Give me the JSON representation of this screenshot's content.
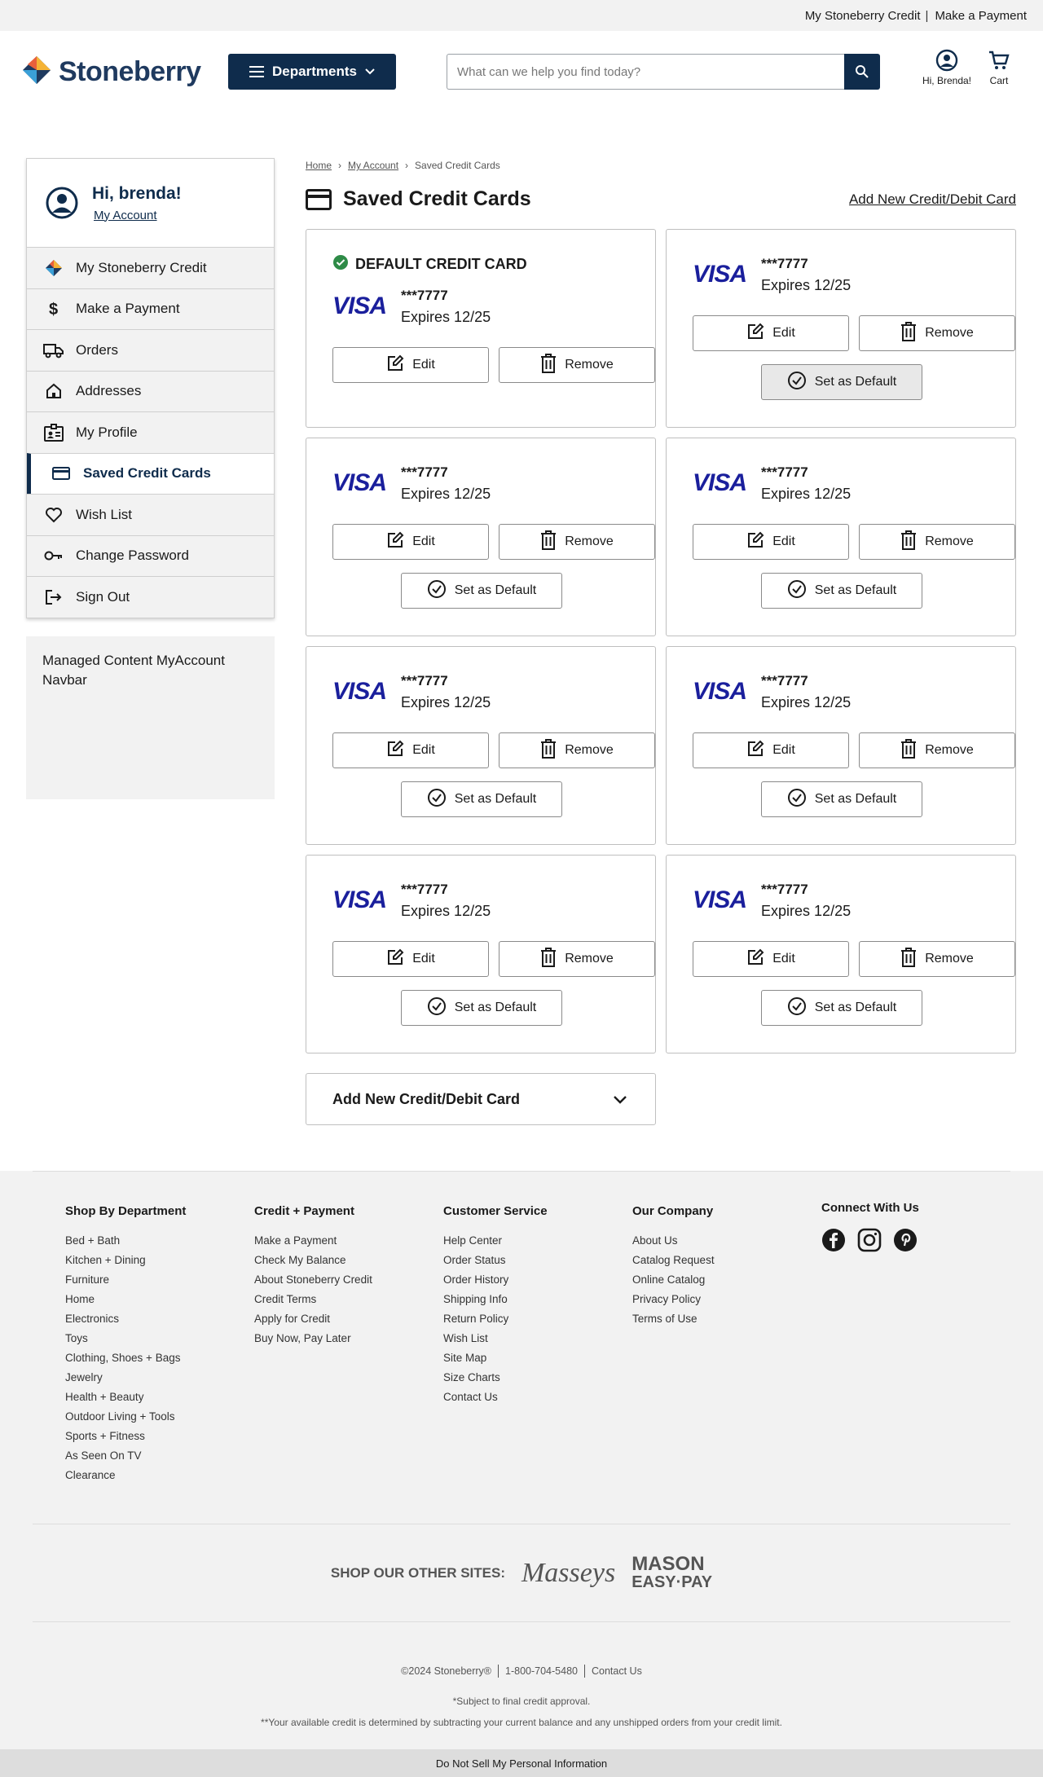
{
  "util_bar": {
    "credit_link": "My Stoneberry Credit",
    "separator": "|",
    "payment_link": "Make a Payment"
  },
  "header": {
    "logo_text": "Stoneberry",
    "departments_label": "Departments",
    "search_placeholder": "What can we help you find today?",
    "account_label": "Hi, Brenda!",
    "cart_label": "Cart"
  },
  "sidebar": {
    "greeting": "Hi, brenda!",
    "account_link": "My Account",
    "items": [
      {
        "label": "My Stoneberry Credit",
        "icon": "stoneberry-logo-icon"
      },
      {
        "label": "Make a Payment",
        "icon": "dollar-icon"
      },
      {
        "label": "Orders",
        "icon": "truck-icon"
      },
      {
        "label": "Addresses",
        "icon": "home-icon"
      },
      {
        "label": "My Profile",
        "icon": "id-card-icon"
      },
      {
        "label": "Saved Credit Cards",
        "icon": "credit-card-icon",
        "active": true
      },
      {
        "label": "Wish List",
        "icon": "heart-icon"
      },
      {
        "label": "Change Password",
        "icon": "key-icon"
      },
      {
        "label": "Sign Out",
        "icon": "sign-out-icon"
      }
    ],
    "managed_content": "Managed Content MyAccount Navbar"
  },
  "breadcrumb": [
    "Home",
    "My Account",
    "Saved Credit Cards"
  ],
  "page": {
    "title": "Saved Credit Cards",
    "add_link": "Add New Credit/Debit Card",
    "default_label": "DEFAULT CREDIT CARD",
    "edit_label": "Edit",
    "remove_label": "Remove",
    "set_default_label": "Set as Default",
    "add_card_panel": "Add New Credit/Debit Card"
  },
  "cards": [
    {
      "brand": "VISA",
      "number": "***7777",
      "expires": "Expires 12/25",
      "is_default": true
    },
    {
      "brand": "VISA",
      "number": "***7777",
      "expires": "Expires 12/25",
      "is_default": false
    },
    {
      "brand": "VISA",
      "number": "***7777",
      "expires": "Expires 12/25",
      "is_default": false
    },
    {
      "brand": "VISA",
      "number": "***7777",
      "expires": "Expires 12/25",
      "is_default": false
    },
    {
      "brand": "VISA",
      "number": "***7777",
      "expires": "Expires 12/25",
      "is_default": false
    },
    {
      "brand": "VISA",
      "number": "***7777",
      "expires": "Expires 12/25",
      "is_default": false
    },
    {
      "brand": "VISA",
      "number": "***7777",
      "expires": "Expires 12/25",
      "is_default": false
    },
    {
      "brand": "VISA",
      "number": "***7777",
      "expires": "Expires 12/25",
      "is_default": false
    }
  ],
  "footer": {
    "columns": [
      {
        "heading": "Shop By Department",
        "links": [
          "Bed + Bath",
          "Kitchen + Dining",
          "Furniture",
          "Home",
          "Electronics",
          "Toys",
          "Clothing, Shoes + Bags",
          "Jewelry",
          "Health + Beauty",
          "Outdoor Living + Tools",
          "Sports + Fitness",
          "As Seen On TV",
          "Clearance"
        ]
      },
      {
        "heading": "Credit + Payment",
        "links": [
          "Make a Payment",
          "Check My Balance",
          "About Stoneberry Credit",
          "Credit Terms",
          "Apply for Credit",
          "Buy Now, Pay Later"
        ]
      },
      {
        "heading": "Customer Service",
        "links": [
          "Help Center",
          "Order Status",
          "Order History",
          "Shipping Info",
          "Return Policy",
          "Wish List",
          "Site Map",
          "Size Charts",
          "Contact Us"
        ]
      },
      {
        "heading": "Our Company",
        "links": [
          "About Us",
          "Catalog Request",
          "Online Catalog",
          "Privacy Policy",
          "Terms of Use"
        ]
      }
    ],
    "connect_heading": "Connect With Us",
    "social": [
      "facebook-icon",
      "instagram-icon",
      "pinterest-icon"
    ],
    "other_sites_label": "SHOP OUR OTHER SITES:",
    "massey_logo": "Masseys",
    "mason_logo_line1": "MASON",
    "mason_logo_line2": "EASY·PAY",
    "copyright": "©2024 Stoneberry®",
    "phone": "1-800-704-5480",
    "contact": "Contact Us",
    "note1": "*Subject to final credit approval.",
    "note2": "**Your available credit is determined by subtracting your current balance and any unshipped orders from your credit limit.",
    "do_not_sell": "Do Not Sell My Personal Information"
  },
  "colors": {
    "brand_navy": "#0f2c4c",
    "visa_blue": "#1a1f9c",
    "default_check": "#2e8b47",
    "panel_gray": "#f2f2f2"
  }
}
